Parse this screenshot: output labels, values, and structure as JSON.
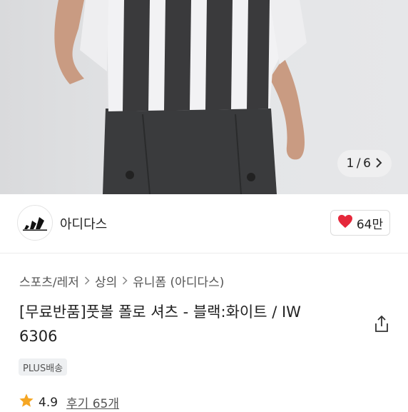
{
  "gallery": {
    "current": "1",
    "total": "6",
    "separator": "/",
    "next_icon": "chevron-right-icon"
  },
  "brand": {
    "name": "아디다스",
    "logo_icon": "adidas-logo-icon"
  },
  "like": {
    "count": "64만",
    "icon": "heart-icon",
    "color": "#e5283b"
  },
  "breadcrumb": [
    "스포츠/레저",
    "상의",
    "유니폼 (아디다스)"
  ],
  "product": {
    "title_line1": "[무료반품]풋볼 폴로 셔츠 - 블랙:화이트 / IW",
    "title_line2": "6306",
    "badge": "PLUS배송",
    "rating": "4.9",
    "reviews_label": "후기 65개"
  },
  "share_icon": "share-icon",
  "colors": {
    "star": "#f5a623",
    "jersey_dark": "#3a3a3c",
    "jersey_light": "#f2f2f4"
  }
}
